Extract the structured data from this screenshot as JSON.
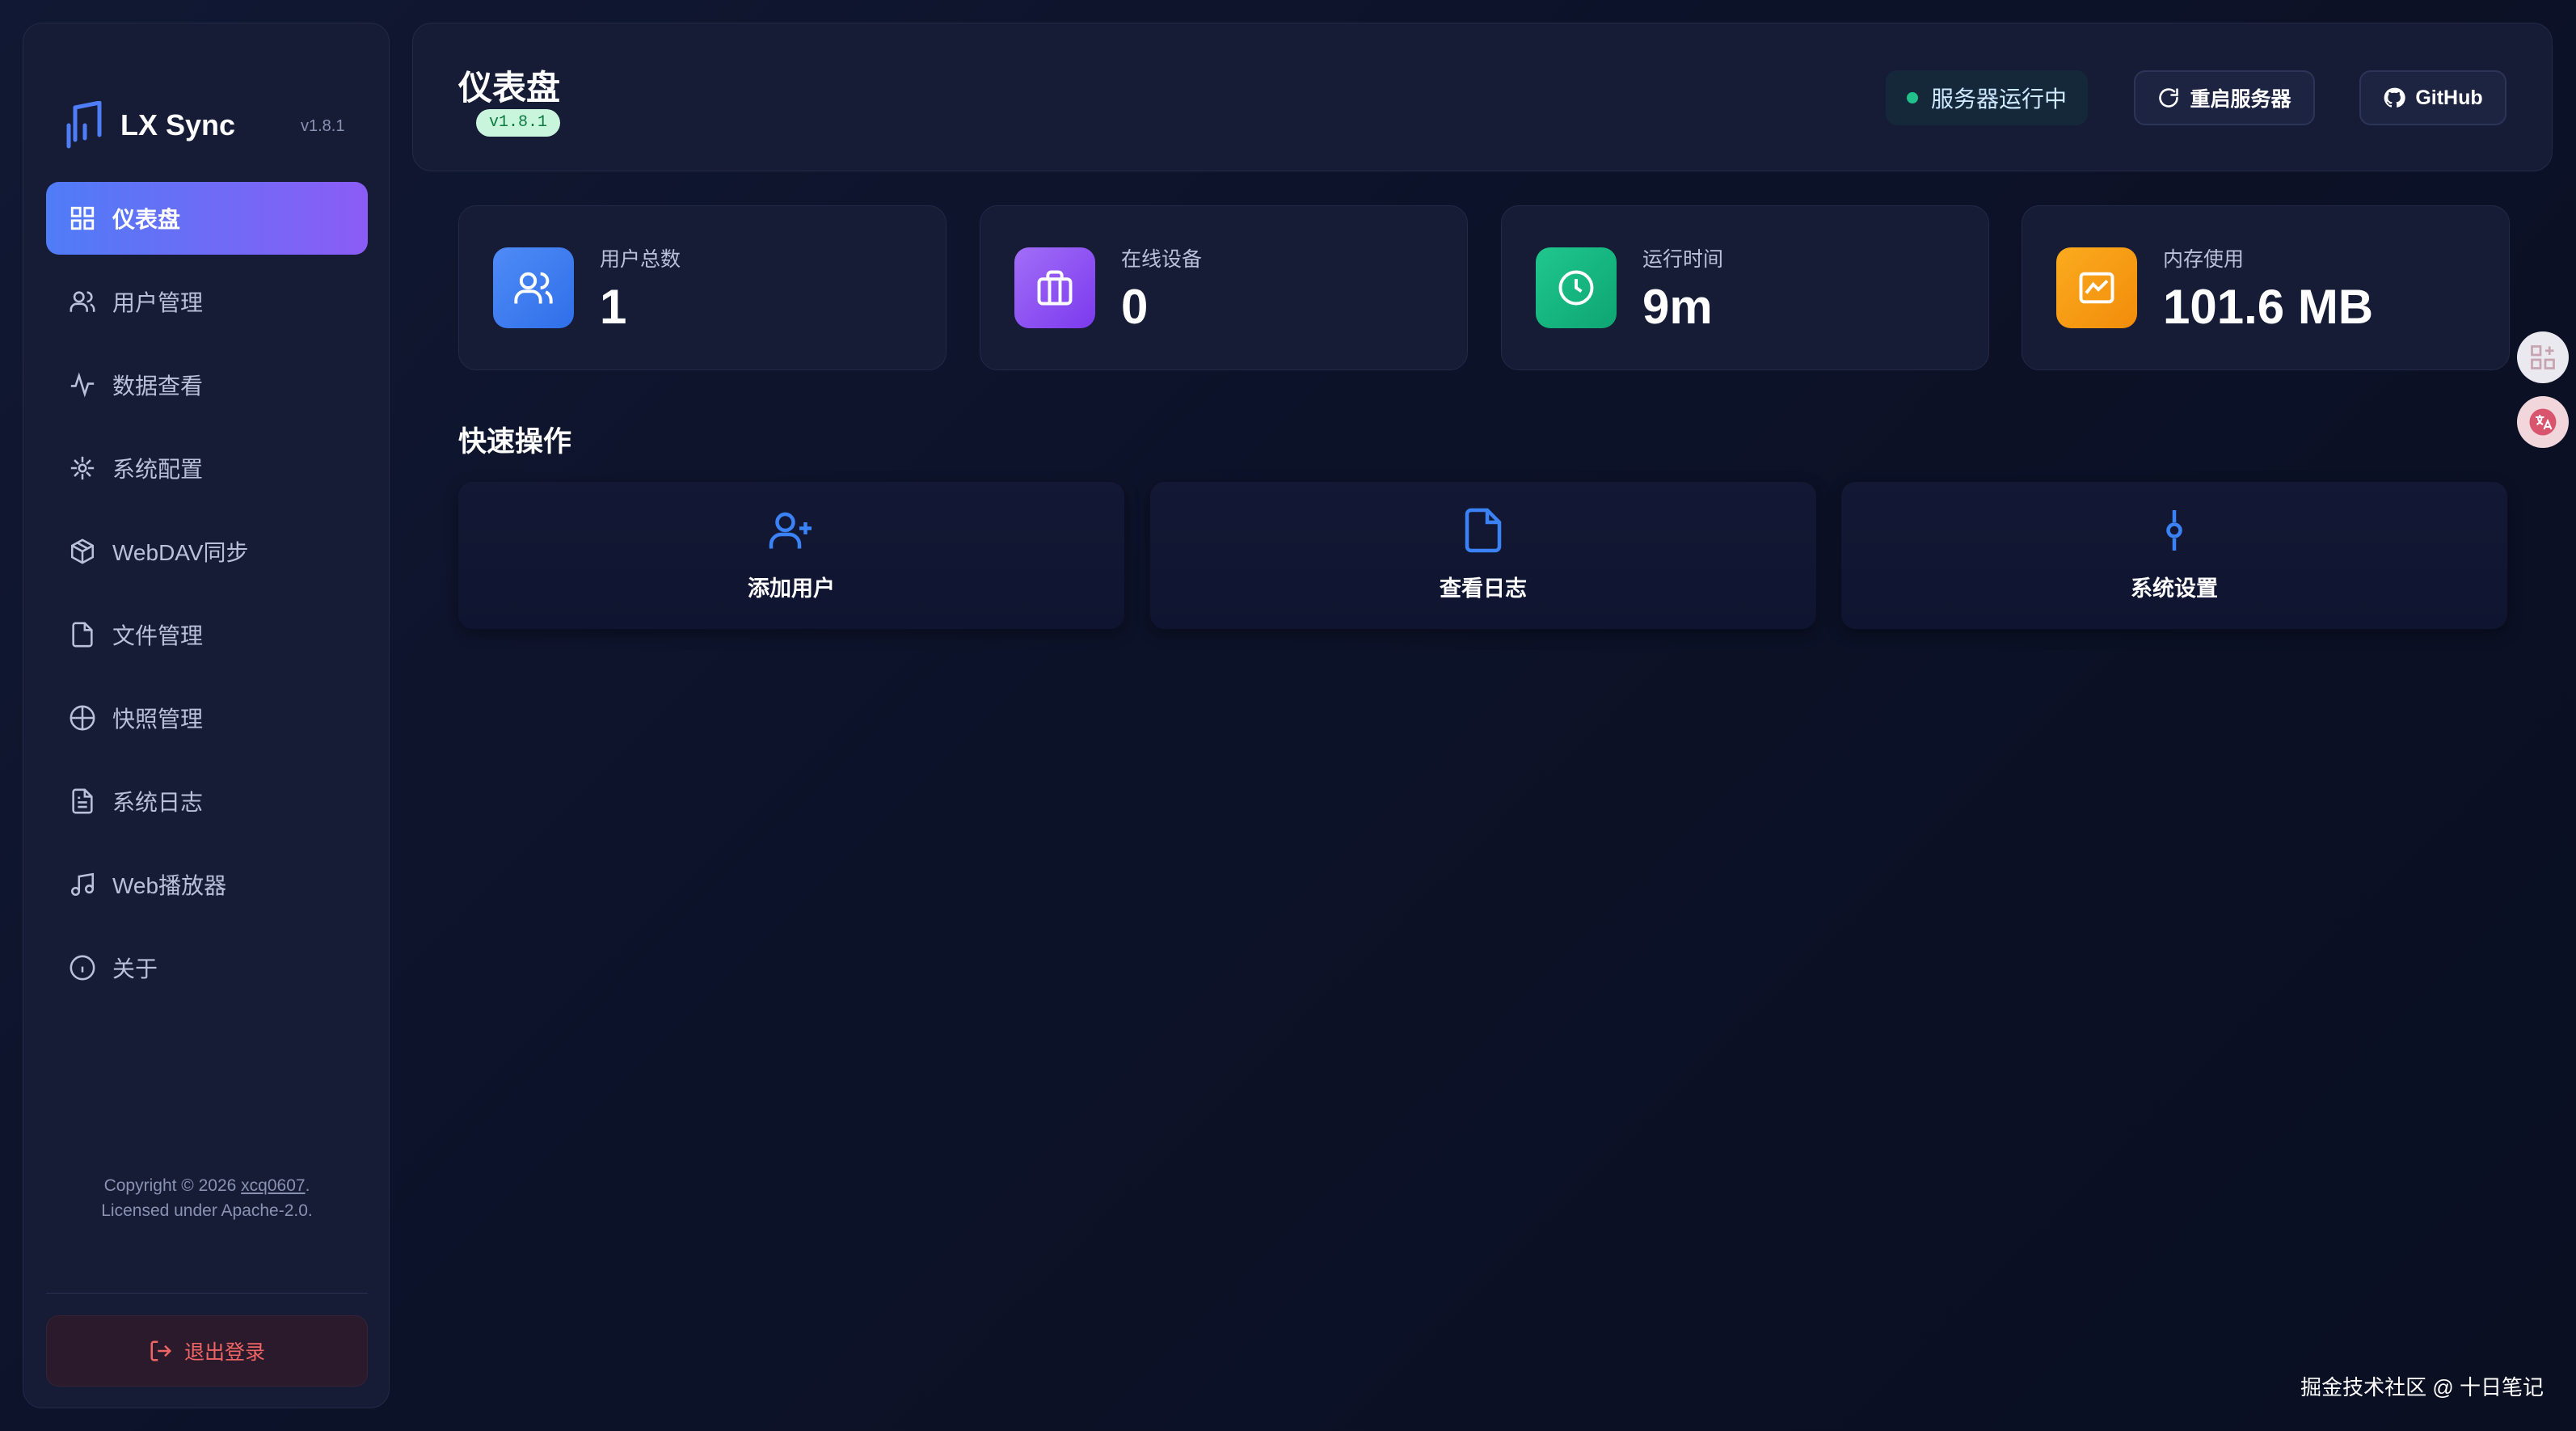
{
  "brand": {
    "name": "LX Sync",
    "version": "v1.8.1",
    "logo_icon": "music-sync-logo"
  },
  "sidebar": {
    "items": [
      {
        "label": "仪表盘",
        "icon": "dashboard-icon",
        "active": true
      },
      {
        "label": "用户管理",
        "icon": "users-icon"
      },
      {
        "label": "数据查看",
        "icon": "activity-icon"
      },
      {
        "label": "系统配置",
        "icon": "config-icon"
      },
      {
        "label": "WebDAV同步",
        "icon": "package-icon"
      },
      {
        "label": "文件管理",
        "icon": "file-icon"
      },
      {
        "label": "快照管理",
        "icon": "snapshot-icon"
      },
      {
        "label": "系统日志",
        "icon": "log-icon"
      },
      {
        "label": "Web播放器",
        "icon": "music-icon"
      },
      {
        "label": "关于",
        "icon": "info-icon"
      }
    ],
    "copyright_prefix": "Copyright © 2026 ",
    "copyright_author": "xcq0607",
    "copyright_suffix": ".",
    "license": "Licensed under Apache-2.0.",
    "logout_label": "退出登录"
  },
  "header": {
    "title": "仪表盘",
    "version_badge": "v1.8.1",
    "status_text": "服务器运行中",
    "restart_label": "重启服务器",
    "github_label": "GitHub"
  },
  "stats": [
    {
      "label": "用户总数",
      "value": "1",
      "icon": "users-icon",
      "color": "#3b82f6"
    },
    {
      "label": "在线设备",
      "value": "0",
      "icon": "briefcase-icon",
      "color": "#8b5cf6"
    },
    {
      "label": "运行时间",
      "value": "9m",
      "icon": "clock-icon",
      "color": "#10b981"
    },
    {
      "label": "内存使用",
      "value": "101.6 MB",
      "icon": "chart-icon",
      "color": "#f59e0b"
    }
  ],
  "quick_actions": {
    "title": "快速操作",
    "items": [
      {
        "label": "添加用户",
        "icon": "user-plus-icon"
      },
      {
        "label": "查看日志",
        "icon": "file-icon"
      },
      {
        "label": "系统设置",
        "icon": "settings-icon"
      }
    ]
  },
  "colors": {
    "accent_start": "#4f7cf7",
    "accent_end": "#8b5cf6",
    "logout": "#f06464",
    "icon_blue": "#3b82f6"
  },
  "watermark": "掘金技术社区 @ 十日笔记"
}
